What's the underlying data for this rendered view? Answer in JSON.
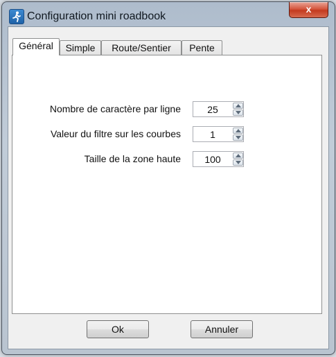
{
  "window": {
    "title": "Configuration  mini roadbook",
    "close_glyph": "x"
  },
  "tabs": [
    {
      "label": "Général",
      "active": true
    },
    {
      "label": "Simple"
    },
    {
      "label": "Route/Sentier"
    },
    {
      "label": "Pente"
    }
  ],
  "fields": [
    {
      "label": "Nombre de caractère par ligne",
      "value": "25"
    },
    {
      "label": "Valeur du filtre sur les courbes",
      "value": "1"
    },
    {
      "label": "Taille de la zone haute",
      "value": "100"
    }
  ],
  "buttons": {
    "ok": "Ok",
    "cancel": "Annuler"
  }
}
